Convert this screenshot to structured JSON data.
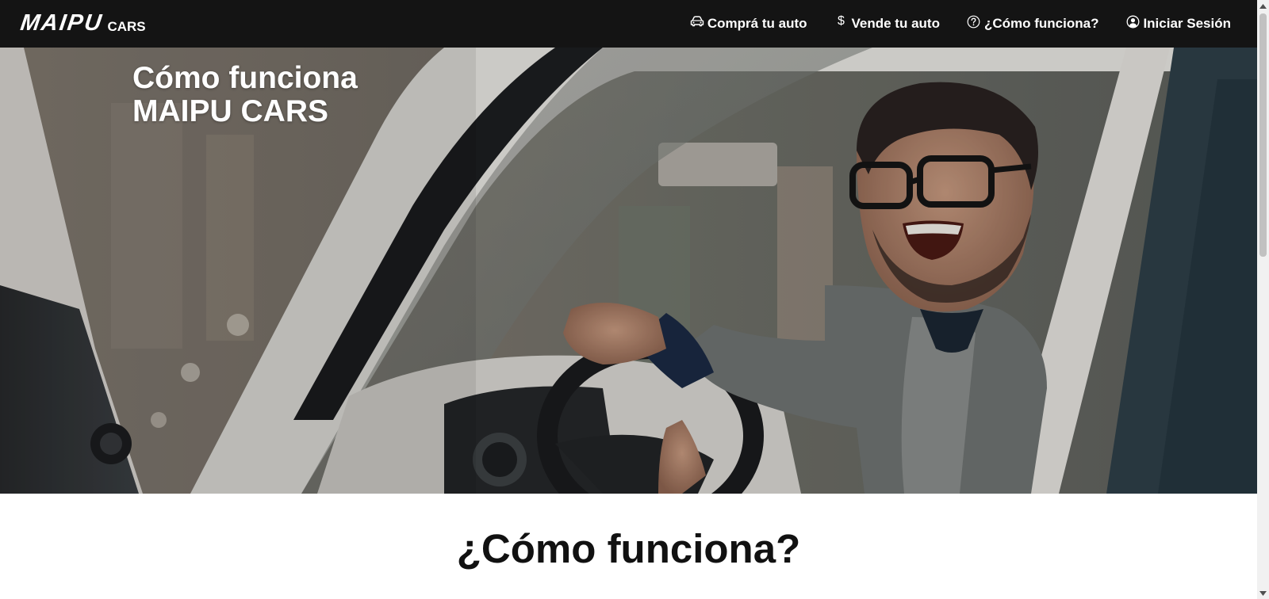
{
  "navbar": {
    "logo_main": "MAIPU",
    "logo_sub": "CARS",
    "links": [
      {
        "label": "Comprá tu auto",
        "icon": "car-icon"
      },
      {
        "label": "Vende tu auto",
        "icon": "dollar-icon"
      },
      {
        "label": "¿Cómo funciona?",
        "icon": "question-circle-icon"
      },
      {
        "label": "Iniciar Sesión",
        "icon": "user-circle-icon"
      }
    ]
  },
  "hero": {
    "title_line1": "Cómo funciona",
    "title_line2": "MAIPU CARS",
    "image": "photo of smiling man with glasses driving a white car"
  },
  "section": {
    "heading": "¿Cómo funciona?"
  },
  "colors": {
    "navbar_bg": "#141414",
    "text_light": "#ffffff",
    "heading_text": "#111111",
    "heading_highlight": "#7a7a7a"
  }
}
